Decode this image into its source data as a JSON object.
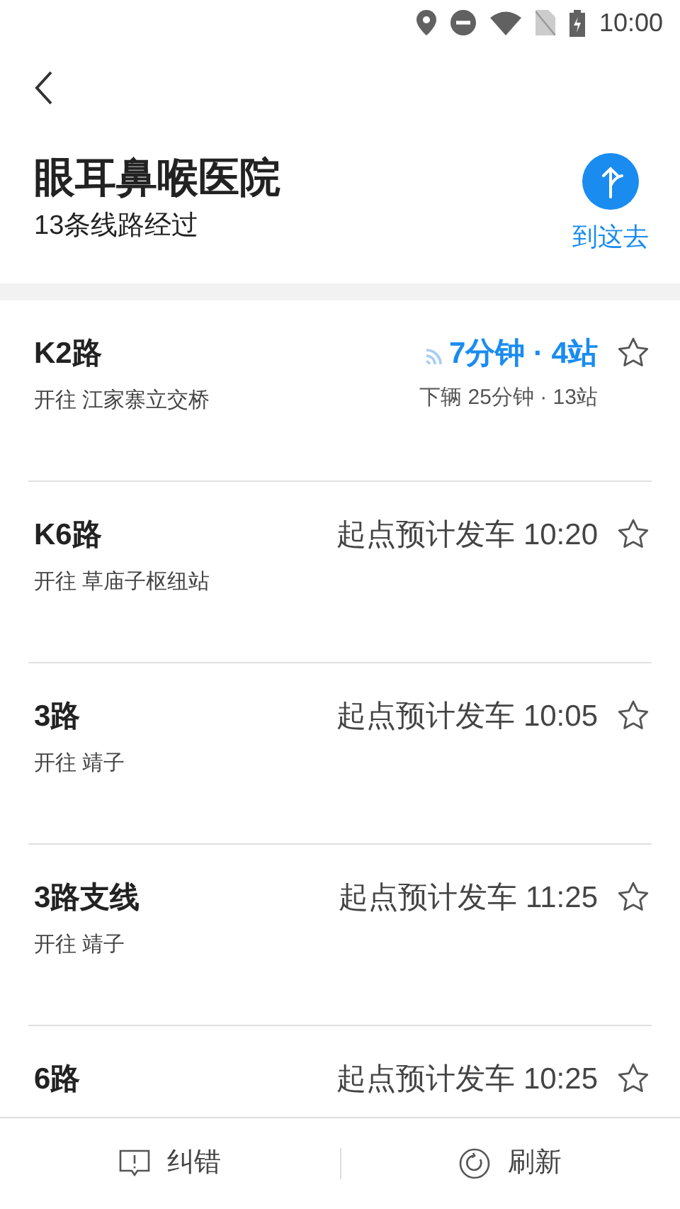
{
  "status_bar": {
    "time": "10:00"
  },
  "place": {
    "name": "眼耳鼻喉医院",
    "subtitle": "13条线路经过",
    "navigate_label": "到这去"
  },
  "routes": [
    {
      "kind": "realtime",
      "name": "K2路",
      "destination": "开往 江家寨立交桥",
      "arrival": "7分钟 · 4站",
      "next": "下辆 25分钟 · 13站"
    },
    {
      "kind": "scheduled",
      "name": "K6路",
      "destination": "开往 草庙子枢纽站",
      "departure": "起点预计发车 10:20"
    },
    {
      "kind": "scheduled",
      "name": "3路",
      "destination": "开往 靖子",
      "departure": "起点预计发车 10:05"
    },
    {
      "kind": "scheduled",
      "name": "3路支线",
      "destination": "开往 靖子",
      "departure": "起点预计发车 11:25"
    },
    {
      "kind": "scheduled",
      "name": "6路",
      "departure": "起点预计发车 10:25"
    }
  ],
  "footer": {
    "report_label": "纠错",
    "refresh_label": "刷新"
  }
}
